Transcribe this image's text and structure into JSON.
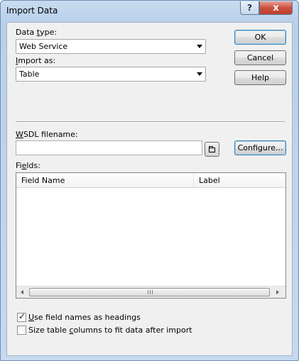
{
  "window": {
    "title": "Import Data",
    "help_glyph": "?",
    "close_glyph": "x"
  },
  "data_type": {
    "label_pre": "Data ",
    "label_u": "t",
    "label_post": "ype:",
    "value": "Web Service"
  },
  "import_as": {
    "label_u": "I",
    "label_post": "mport as:",
    "value": "Table"
  },
  "buttons": {
    "ok": "OK",
    "cancel": "Cancel",
    "help": "Help",
    "configure": "Configure..."
  },
  "wsdl": {
    "label_u": "W",
    "label_post": "SDL filename:",
    "value": ""
  },
  "fields": {
    "label_pre": "Fi",
    "label_u": "e",
    "label_post": "lds:",
    "columns": [
      "Field Name",
      "Label"
    ],
    "rows": []
  },
  "options": {
    "use_names": {
      "label_u": "U",
      "label_post": "se field names as headings",
      "checked": true
    },
    "size_cols": {
      "label_pre": "Size table ",
      "label_u": "c",
      "label_post": "olumns to fit data after import",
      "checked": false
    }
  }
}
